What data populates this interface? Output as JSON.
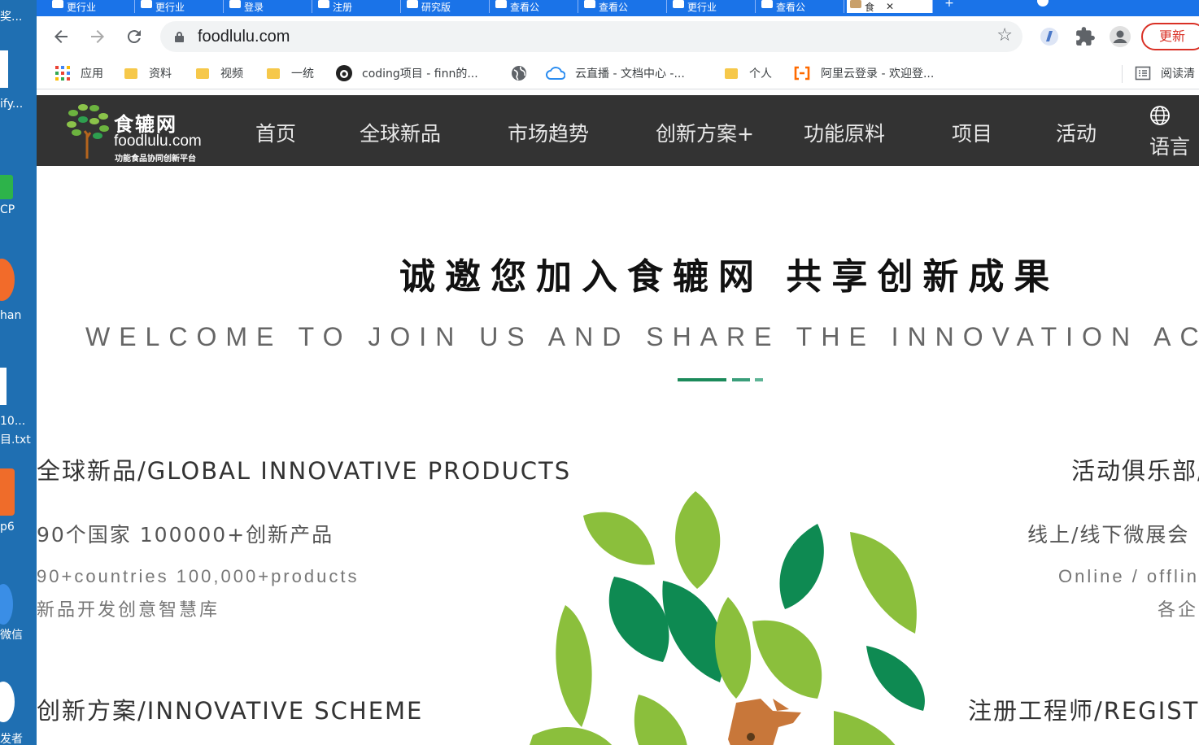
{
  "desktop": {
    "labels": [
      "奖...",
      "ify...",
      "CP",
      "han",
      "10...",
      "目.txt",
      "p6",
      "微信",
      "发者"
    ]
  },
  "browser": {
    "tabs": [
      {
        "label": "更行业"
      },
      {
        "label": "更行业"
      },
      {
        "label": "登录"
      },
      {
        "label": "注册"
      },
      {
        "label": "研究版"
      },
      {
        "label": "查看公"
      },
      {
        "label": "查看公"
      },
      {
        "label": "更行业"
      },
      {
        "label": "查看公"
      },
      {
        "label": "食"
      }
    ],
    "new_tab_label": "+",
    "url": "foodlulu.com",
    "update_label": "更新",
    "bookmarks": [
      {
        "label": "应用",
        "icon": "apps-grid-icon"
      },
      {
        "label": "资料",
        "icon": "folder-icon"
      },
      {
        "label": "视频",
        "icon": "folder-icon"
      },
      {
        "label": "一统",
        "icon": "folder-icon"
      },
      {
        "label": "coding项目 - finn的...",
        "icon": "coding-icon"
      },
      {
        "label": "",
        "icon": "globe-icon"
      },
      {
        "label": "云直播 - 文档中心 -...",
        "icon": "cloud-icon"
      },
      {
        "label": "个人",
        "icon": "folder-icon"
      },
      {
        "label": "阿里云登录 - 欢迎登...",
        "icon": "aliyun-icon"
      },
      {
        "label": "阅读清",
        "icon": "reading-list-icon"
      }
    ]
  },
  "site": {
    "logo": {
      "title": "食辘网",
      "url": "foodlulu.com",
      "tagline": "功能食品协同创新平台"
    },
    "nav": [
      {
        "label": "首页"
      },
      {
        "label": "全球新品"
      },
      {
        "label": "市场趋势"
      },
      {
        "label": "创新方案+"
      },
      {
        "label": "功能原料"
      },
      {
        "label": "项目"
      },
      {
        "label": "活动"
      },
      {
        "label": "语言"
      }
    ],
    "hero": {
      "headline": "诚邀您加入食辘网 共享创新成果",
      "subline": "WELCOME TO JOIN US AND SHARE THE INNOVATION ACHIEVEMENTS"
    },
    "sections": {
      "global": {
        "title": "全球新品/GLOBAL INNOVATIVE PRODUCTS",
        "sub": "90个国家 100000+创新产品",
        "en": "90+countries 100,000+products",
        "desc": "新品开发创意智慧库"
      },
      "activity": {
        "title": "活动俱乐部/",
        "sub": "线上/线下微展会",
        "en": "Online / offlin",
        "desc": "各企"
      },
      "scheme": {
        "title": "创新方案/INNOVATIVE SCHEME"
      },
      "engineer": {
        "title": "注册工程师/REGISTI"
      }
    },
    "brand_color": "#1b8a5a",
    "nav_bg": "#333333"
  }
}
